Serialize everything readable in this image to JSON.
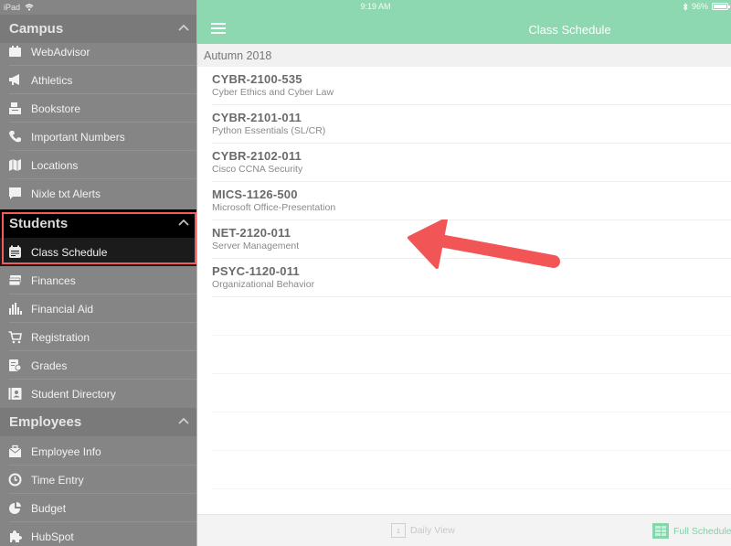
{
  "status_bar": {
    "device": "iPad",
    "time": "9:19 AM",
    "battery": "96%"
  },
  "sidebar": {
    "sections": [
      {
        "title": "Campus",
        "items": [
          {
            "label": "WebAdvisor",
            "icon": "calendar-icon"
          },
          {
            "label": "Athletics",
            "icon": "megaphone-icon"
          },
          {
            "label": "Bookstore",
            "icon": "cash-register-icon"
          },
          {
            "label": "Important Numbers",
            "icon": "phone-icon"
          },
          {
            "label": "Locations",
            "icon": "map-icon"
          },
          {
            "label": "Nixle txt Alerts",
            "icon": "chat-bubble-icon"
          }
        ]
      },
      {
        "title": "Students",
        "items": [
          {
            "label": "Class Schedule",
            "icon": "schedule-icon",
            "selected": true
          },
          {
            "label": "Finances",
            "icon": "credit-card-icon"
          },
          {
            "label": "Financial Aid",
            "icon": "bar-chart-icon"
          },
          {
            "label": "Registration",
            "icon": "cart-icon"
          },
          {
            "label": "Grades",
            "icon": "certificate-icon"
          },
          {
            "label": "Student Directory",
            "icon": "address-book-icon"
          }
        ]
      },
      {
        "title": "Employees",
        "items": [
          {
            "label": "Employee Info",
            "icon": "briefcase-icon"
          },
          {
            "label": "Time Entry",
            "icon": "clock-icon"
          },
          {
            "label": "Budget",
            "icon": "pie-chart-icon"
          },
          {
            "label": "HubSpot",
            "icon": "puzzle-icon"
          }
        ]
      }
    ]
  },
  "header": {
    "title": "Class Schedule",
    "menu_icon": "hamburger-icon"
  },
  "schedule": {
    "term": "Autumn 2018",
    "courses": [
      {
        "code": "CYBR-2100-535",
        "name": "Cyber Ethics and Cyber Law"
      },
      {
        "code": "CYBR-2101-011",
        "name": "Python Essentials (SL/CR)"
      },
      {
        "code": "CYBR-2102-011",
        "name": "Cisco CCNA Security"
      },
      {
        "code": "MICS-1126-500",
        "name": "Microsoft Office-Presentation"
      },
      {
        "code": "NET-2120-011",
        "name": "Server Management"
      },
      {
        "code": "PSYC-1120-011",
        "name": "Organizational Behavior"
      }
    ]
  },
  "bottom_tabs": {
    "daily": {
      "label": "Daily View",
      "icon_day": "1"
    },
    "full": {
      "label": "Full Schedule"
    }
  },
  "colors": {
    "accent": "#8dd8b0",
    "highlight": "#f25c5c",
    "sidebar_bg": "#858585"
  }
}
